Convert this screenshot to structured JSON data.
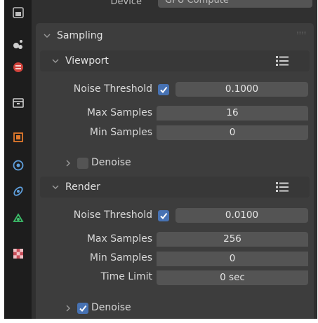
{
  "top_row": {
    "label": "Device",
    "value": "GPU Compute"
  },
  "sampling": {
    "title": "Sampling",
    "viewport": {
      "title": "Viewport",
      "noise_threshold_label": "Noise Threshold",
      "noise_threshold_enabled": true,
      "noise_threshold_value": "0.1000",
      "max_samples_label": "Max Samples",
      "max_samples_value": "16",
      "min_samples_label": "Min Samples",
      "min_samples_value": "0",
      "denoise_label": "Denoise",
      "denoise_enabled": false
    },
    "render": {
      "title": "Render",
      "noise_threshold_label": "Noise Threshold",
      "noise_threshold_enabled": true,
      "noise_threshold_value": "0.0100",
      "max_samples_label": "Max Samples",
      "max_samples_value": "256",
      "min_samples_label": "Min Samples",
      "min_samples_value": "0",
      "time_limit_label": "Time Limit",
      "time_limit_value": "0 sec",
      "denoise_label": "Denoise",
      "denoise_enabled": true
    }
  },
  "sidebar_icons": [
    "tool-icon",
    "render-icon",
    "output-icon",
    "view-layer-icon",
    "scene-icon",
    "world-icon",
    "object-icon",
    "modifier-icon",
    "particles-icon",
    "physics-icon",
    "texture-icon"
  ],
  "colors": {
    "accent": "#4772b3",
    "panel": "#3d3d3d",
    "field": "#545454"
  }
}
